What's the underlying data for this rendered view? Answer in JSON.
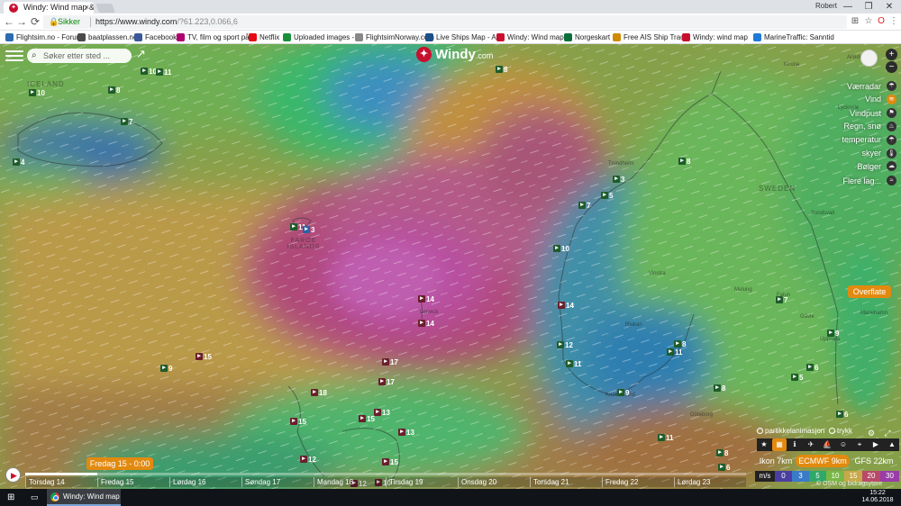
{
  "browser": {
    "tab_title": "Windy: Wind map & wea",
    "tab_close": "×",
    "user": "Robert",
    "window_controls": [
      "—",
      "❐",
      "✕"
    ],
    "secure_label": "Sikker",
    "url_host": "https://www.windy.com",
    "url_path": "/?61.223,0.066,6",
    "nav": [
      "←",
      "→",
      "⟳"
    ]
  },
  "bookmarks": [
    {
      "label": "Flightsim.no - Forum",
      "color": "#2b6cb0"
    },
    {
      "label": "baatplassen.no",
      "color": "#4a4a4a"
    },
    {
      "label": "Facebook",
      "color": "#3b5998"
    },
    {
      "label": "TV, film og sport på",
      "color": "#b0006e"
    },
    {
      "label": "Netflix",
      "color": "#e50914"
    },
    {
      "label": "Uploaded images - ",
      "color": "#1a8f3a"
    },
    {
      "label": "FlightsimNorway.com",
      "color": "#888888"
    },
    {
      "label": "Live Ships Map - AIS",
      "color": "#1b4f8a"
    },
    {
      "label": "Windy: Wind map &",
      "color": "#c8102e"
    },
    {
      "label": "Norgeskart",
      "color": "#0a6e3a"
    },
    {
      "label": "Free AIS Ship Tracki",
      "color": "#d08a00"
    },
    {
      "label": "Windy: wind map",
      "color": "#c8102e"
    },
    {
      "label": "MarineTraffic: Sanntid",
      "color": "#1d7ad8"
    }
  ],
  "map": {
    "search_placeholder": "Søker etter sted ...",
    "logo_text": "Windy",
    "logo_suffix": ".com",
    "regions": [
      "ICELAND",
      "FAROE ISLANDS",
      "SWEDEN"
    ],
    "places": [
      "Lerwick",
      "Trondheim",
      "Vinstra",
      "Rjukan",
      "Oslo",
      "Kristiansand",
      "Göteborg",
      "Falun",
      "Sundsvall",
      "Malung",
      "Uppsala",
      "Gävle",
      "Mariehamn",
      "Arvidsjaur",
      "Lycksele",
      "Kiruna"
    ],
    "wind_labels": [
      {
        "v": "10"
      },
      {
        "v": "10"
      },
      {
        "v": "11"
      },
      {
        "v": "8"
      },
      {
        "v": "8"
      },
      {
        "v": "7"
      },
      {
        "v": "4"
      },
      {
        "v": "11"
      },
      {
        "v": "3"
      },
      {
        "v": "14"
      },
      {
        "v": "14"
      },
      {
        "v": "15"
      },
      {
        "v": "9"
      },
      {
        "v": "17"
      },
      {
        "v": "17"
      },
      {
        "v": "18"
      },
      {
        "v": "15"
      },
      {
        "v": "15"
      },
      {
        "v": "13"
      },
      {
        "v": "13"
      },
      {
        "v": "12"
      },
      {
        "v": "15"
      },
      {
        "v": "12"
      },
      {
        "v": "10"
      },
      {
        "v": "7"
      },
      {
        "v": "5"
      },
      {
        "v": "3"
      },
      {
        "v": "10"
      },
      {
        "v": "14"
      },
      {
        "v": "12"
      },
      {
        "v": "11"
      },
      {
        "v": "9"
      },
      {
        "v": "8"
      },
      {
        "v": "8"
      },
      {
        "v": "11"
      },
      {
        "v": "8"
      },
      {
        "v": "7"
      },
      {
        "v": "9"
      },
      {
        "v": "5"
      },
      {
        "v": "6"
      },
      {
        "v": "6"
      },
      {
        "v": "11"
      },
      {
        "v": "8"
      },
      {
        "v": "6"
      }
    ]
  },
  "layers": [
    "Værradar",
    "Vind",
    "Vindpust",
    "Regn, snø",
    "temperatur",
    "skyer",
    "Bølger",
    "Flere lag..."
  ],
  "layer_icons": [
    "☂",
    "≋",
    "⚑",
    "♨",
    "☂",
    "🌡",
    "☁",
    "≈"
  ],
  "surface_button": "Overflate",
  "options": {
    "particles": "partikkelanimasjon",
    "pressure": "trykk"
  },
  "models": {
    "ikon": "Ikon 7km",
    "ecmwf": "ECMWF 9km",
    "gfs": "GFS 22km"
  },
  "scale": {
    "unit": "m/s",
    "values": [
      "0",
      "3",
      "5",
      "10",
      "15",
      "20",
      "30"
    ],
    "colors": [
      "#4a3fa0",
      "#3a7bc8",
      "#2fa86a",
      "#78b846",
      "#c8a848",
      "#b84a68",
      "#9a3ca8"
    ]
  },
  "attribution": "© OSM og bidragsytere",
  "timeline": {
    "current": "Fredag 15 - 0:00",
    "progress": 0.1,
    "days": [
      "Torsdag 14",
      "Fredag 15",
      "Lørdag 16",
      "Søndag 17",
      "Mandag 18",
      "Tirsdag 19",
      "Onsdag 20",
      "Torsdag 21",
      "Fredag 22",
      "Lørdag 23"
    ]
  },
  "taskbar": {
    "app_title": "Windy: Wind map ...",
    "time": "15:22",
    "date": "14.06.2018"
  },
  "colors": {
    "accent": "#e28a10",
    "brand": "#c8102e"
  }
}
